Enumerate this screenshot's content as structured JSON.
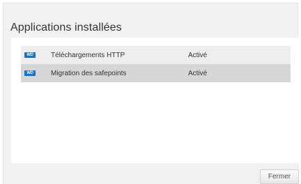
{
  "dialog": {
    "title": "Applications installées",
    "close_label": "Fermer"
  },
  "apps": [
    {
      "icon": "wd-logo-icon",
      "icon_text": "WD",
      "name": "Téléchargements HTTP",
      "status": "Activé"
    },
    {
      "icon": "wd-logo-icon",
      "icon_text": "WD",
      "name": "Migration des safepoints",
      "status": "Activé"
    }
  ],
  "colors": {
    "icon_blue": "#1f6fc0",
    "row_bg": "#eeeeee",
    "row_selected_bg": "#d6d6d6"
  }
}
